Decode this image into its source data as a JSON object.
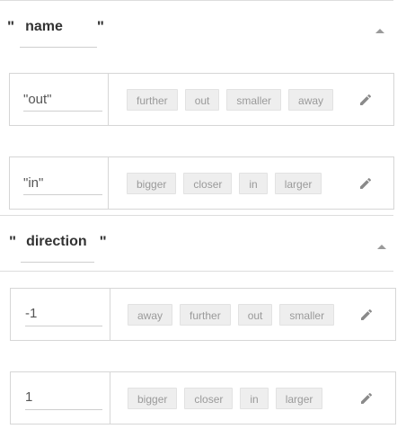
{
  "sections": [
    {
      "open_quote": "\"",
      "slot": "name",
      "close_quote": "\"",
      "rows": [
        {
          "value": "\"out\"",
          "synonyms": [
            "further",
            "out",
            "smaller",
            "away"
          ]
        },
        {
          "value": "\"in\"",
          "synonyms": [
            "bigger",
            "closer",
            "in",
            "larger"
          ]
        }
      ]
    },
    {
      "open_quote": "\"",
      "slot": "direction",
      "close_quote": "\"",
      "rows": [
        {
          "value": "-1",
          "synonyms": [
            "away",
            "further",
            "out",
            "smaller"
          ]
        },
        {
          "value": "1",
          "synonyms": [
            "bigger",
            "closer",
            "in",
            "larger"
          ]
        }
      ]
    }
  ],
  "icons": {
    "collapse": "chevron-up-icon",
    "edit": "pencil-icon"
  },
  "colors": {
    "chip_bg": "#eeeeee",
    "chip_text": "#9a9a9a",
    "border": "#d6d6d6"
  }
}
